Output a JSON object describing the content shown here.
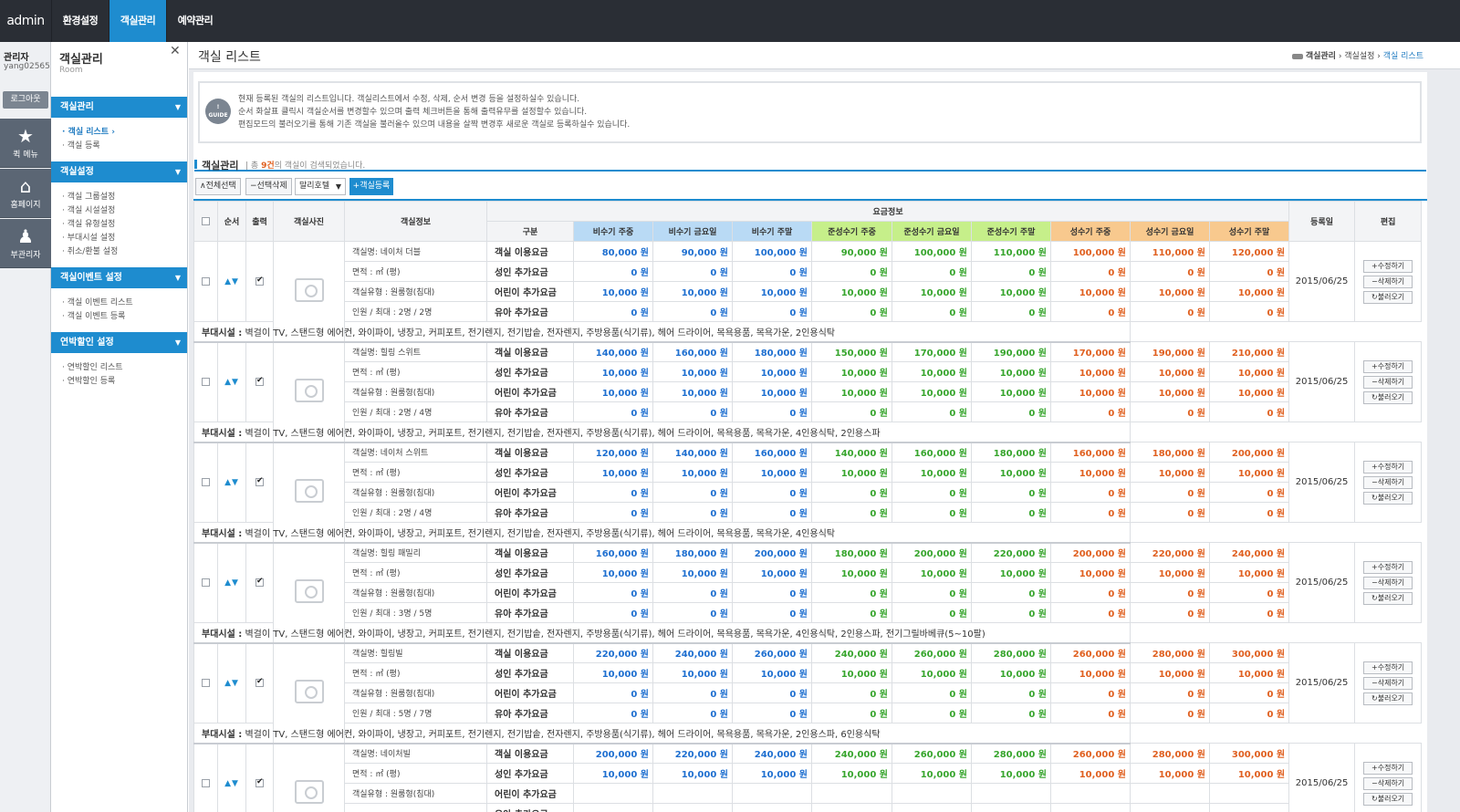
{
  "top": {
    "logo": "admin",
    "menus": [
      {
        "label": "환경설정"
      },
      {
        "label": "객실관리"
      },
      {
        "label": "예약관리"
      }
    ]
  },
  "leftstrip": {
    "admin_label": "관리자",
    "admin_id": "yang02565",
    "logout": "로그아웃",
    "quick": [
      {
        "icon": "star-icon",
        "label": "퀵 메뉴"
      },
      {
        "icon": "home-search-icon",
        "label": "홈페이지"
      },
      {
        "icon": "sub-admin-icon",
        "label": "부관리자"
      }
    ]
  },
  "sidebar": {
    "title": "객실관리",
    "subtitle": "Room",
    "groups": [
      {
        "label": "객실관리",
        "items": [
          "· 객실 리스트 ›",
          "· 객실 등록"
        ]
      },
      {
        "label": "객실설정",
        "items": [
          "· 객실 그룹설정",
          "· 객실 시설설정",
          "· 객실 유형설정",
          "· 부대시설 설정",
          "· 취소/환불 설정"
        ]
      },
      {
        "label": "객실이벤트 설정",
        "items": [
          "· 객실 이벤트 리스트",
          "· 객실 이벤트 등록"
        ]
      },
      {
        "label": "연박할인 설정",
        "items": [
          "· 연박할인 리스트",
          "· 연박할인 등록"
        ]
      }
    ]
  },
  "page": {
    "title": "객실 리스트",
    "breadcrumb": [
      "객실관리",
      "객실설정",
      "객실 리스트"
    ],
    "guide_icon": "GUIDE",
    "guide": [
      "현재 등록된 객실의 리스트입니다. 객실리스트에서 수정, 삭제, 순서 변경 등을 설정하실수 있습니다.",
      "순서 화살표 클릭시 객실순서를 변경할수 있으며 출력 체크버튼을 통해 출력유무를 설정할수 있습니다.",
      "편집모드의 불러오기를 통해 기존 객실을 불러올수 있으며 내용을 살짝 변경후 새로운 객실로 등록하실수 있습니다."
    ],
    "section_title": "객실관리",
    "section_info_pre": "총",
    "section_info_count": "9건",
    "section_info_post": "의 객실이 검색되었습니다.",
    "toolbar": {
      "select_all": "∧전체선택",
      "delete_selected": "−선택삭제",
      "select_value": "말리호텔",
      "register": "+객실등록"
    }
  },
  "table": {
    "headers": {
      "order": "순서",
      "output": "출력",
      "photo": "객실사진",
      "info": "객실정보",
      "price_group": "요금정보",
      "category": "구분",
      "regdate": "등록일",
      "edit": "편집",
      "seasons": [
        "비수기 주중",
        "비수기 금요일",
        "비수기 주말",
        "준성수기 주중",
        "준성수기 금요일",
        "준성수기 주말",
        "성수기 주중",
        "성수기 금요일",
        "성수기 주말"
      ]
    },
    "price_labels": [
      "객실 이용요금",
      "성인 추가요금",
      "어린이 추가요금",
      "유아 추가요금"
    ],
    "facility_label": "부대시설 :",
    "edit_buttons": [
      "+수정하기",
      "−삭제하기",
      "↻불러오기"
    ],
    "rows": [
      {
        "name": "객실명: 네이처 더블",
        "area": "면적 : ㎡ (평)",
        "type": "객실유형 : 원룸형(침대)",
        "people": "인원 / 최대 : 2명 / 2명",
        "date": "2015/06/25",
        "prices": [
          [
            "80,000 원",
            "90,000 원",
            "100,000 원",
            "90,000 원",
            "100,000 원",
            "110,000 원",
            "100,000 원",
            "110,000 원",
            "120,000 원"
          ],
          [
            "0 원",
            "0 원",
            "0 원",
            "0 원",
            "0 원",
            "0 원",
            "0 원",
            "0 원",
            "0 원"
          ],
          [
            "10,000 원",
            "10,000 원",
            "10,000 원",
            "10,000 원",
            "10,000 원",
            "10,000 원",
            "10,000 원",
            "10,000 원",
            "10,000 원"
          ],
          [
            "0 원",
            "0 원",
            "0 원",
            "0 원",
            "0 원",
            "0 원",
            "0 원",
            "0 원",
            "0 원"
          ]
        ],
        "facilities": "벽걸이 TV, 스탠드형 에어컨, 와이파이, 냉장고, 커피포트, 전기렌지, 전기밥솥, 전자렌지, 주방용품(식기류), 헤어 드라이어, 목욕용품, 목욕가운, 2인용식탁"
      },
      {
        "name": "객실명: 힐링 스위트",
        "area": "면적 : ㎡ (평)",
        "type": "객실유형 : 원룸형(침대)",
        "people": "인원 / 최대 : 2명 / 4명",
        "date": "2015/06/25",
        "prices": [
          [
            "140,000 원",
            "160,000 원",
            "180,000 원",
            "150,000 원",
            "170,000 원",
            "190,000 원",
            "170,000 원",
            "190,000 원",
            "210,000 원"
          ],
          [
            "10,000 원",
            "10,000 원",
            "10,000 원",
            "10,000 원",
            "10,000 원",
            "10,000 원",
            "10,000 원",
            "10,000 원",
            "10,000 원"
          ],
          [
            "10,000 원",
            "10,000 원",
            "10,000 원",
            "10,000 원",
            "10,000 원",
            "10,000 원",
            "10,000 원",
            "10,000 원",
            "10,000 원"
          ],
          [
            "0 원",
            "0 원",
            "0 원",
            "0 원",
            "0 원",
            "0 원",
            "0 원",
            "0 원",
            "0 원"
          ]
        ],
        "facilities": "벽걸이 TV, 스탠드형 에어컨, 와이파이, 냉장고, 커피포트, 전기렌지, 전기밥솥, 전자렌지, 주방용품(식기류), 헤어 드라이어, 목욕용품, 목욕가운, 4인용식탁, 2인용스파"
      },
      {
        "name": "객실명: 네이처 스위트",
        "area": "면적 : ㎡ (평)",
        "type": "객실유형 : 원룸형(침대)",
        "people": "인원 / 최대 : 2명 / 4명",
        "date": "2015/06/25",
        "prices": [
          [
            "120,000 원",
            "140,000 원",
            "160,000 원",
            "140,000 원",
            "160,000 원",
            "180,000 원",
            "160,000 원",
            "180,000 원",
            "200,000 원"
          ],
          [
            "10,000 원",
            "10,000 원",
            "10,000 원",
            "10,000 원",
            "10,000 원",
            "10,000 원",
            "10,000 원",
            "10,000 원",
            "10,000 원"
          ],
          [
            "0 원",
            "0 원",
            "0 원",
            "0 원",
            "0 원",
            "0 원",
            "0 원",
            "0 원",
            "0 원"
          ],
          [
            "0 원",
            "0 원",
            "0 원",
            "0 원",
            "0 원",
            "0 원",
            "0 원",
            "0 원",
            "0 원"
          ]
        ],
        "facilities": "벽걸이 TV, 스탠드형 에어컨, 와이파이, 냉장고, 커피포트, 전기렌지, 전기밥솥, 전자렌지, 주방용품(식기류), 헤어 드라이어, 목욕용품, 목욕가운, 4인용식탁"
      },
      {
        "name": "객실명: 힐링 패밀리",
        "area": "면적 : ㎡ (평)",
        "type": "객실유형 : 원룸형(침대)",
        "people": "인원 / 최대 : 3명 / 5명",
        "date": "2015/06/25",
        "prices": [
          [
            "160,000 원",
            "180,000 원",
            "200,000 원",
            "180,000 원",
            "200,000 원",
            "220,000 원",
            "200,000 원",
            "220,000 원",
            "240,000 원"
          ],
          [
            "10,000 원",
            "10,000 원",
            "10,000 원",
            "10,000 원",
            "10,000 원",
            "10,000 원",
            "10,000 원",
            "10,000 원",
            "10,000 원"
          ],
          [
            "0 원",
            "0 원",
            "0 원",
            "0 원",
            "0 원",
            "0 원",
            "0 원",
            "0 원",
            "0 원"
          ],
          [
            "0 원",
            "0 원",
            "0 원",
            "0 원",
            "0 원",
            "0 원",
            "0 원",
            "0 원",
            "0 원"
          ]
        ],
        "facilities": "벽걸이 TV, 스탠드형 에어컨, 와이파이, 냉장고, 커피포트, 전기렌지, 전기밥솥, 전자렌지, 주방용품(식기류), 헤어 드라이어, 목욕용품, 목욕가운, 4인용식탁, 2인용스파, 전기그릴바베큐(5~10팔)"
      },
      {
        "name": "객실명: 힐링빌",
        "area": "면적 : ㎡ (평)",
        "type": "객실유형 : 원룸형(침대)",
        "people": "인원 / 최대 : 5명 / 7명",
        "date": "2015/06/25",
        "prices": [
          [
            "220,000 원",
            "240,000 원",
            "260,000 원",
            "240,000 원",
            "260,000 원",
            "280,000 원",
            "260,000 원",
            "280,000 원",
            "300,000 원"
          ],
          [
            "10,000 원",
            "10,000 원",
            "10,000 원",
            "10,000 원",
            "10,000 원",
            "10,000 원",
            "10,000 원",
            "10,000 원",
            "10,000 원"
          ],
          [
            "0 원",
            "0 원",
            "0 원",
            "0 원",
            "0 원",
            "0 원",
            "0 원",
            "0 원",
            "0 원"
          ],
          [
            "0 원",
            "0 원",
            "0 원",
            "0 원",
            "0 원",
            "0 원",
            "0 원",
            "0 원",
            "0 원"
          ]
        ],
        "facilities": "벽걸이 TV, 스탠드형 에어컨, 와이파이, 냉장고, 커피포트, 전기렌지, 전기밥솥, 전자렌지, 주방용품(식기류), 헤어 드라이어, 목욕용품, 목욕가운, 2인용스파, 6인용식탁"
      },
      {
        "name": "객실명: 네이처빌",
        "area": "면적 : ㎡ (평)",
        "type": "객실유형 : 원룸형(침대)",
        "people": "",
        "date": "2015/06/25",
        "prices": [
          [
            "200,000 원",
            "220,000 원",
            "240,000 원",
            "240,000 원",
            "260,000 원",
            "280,000 원",
            "260,000 원",
            "280,000 원",
            "300,000 원"
          ],
          [
            "10,000 원",
            "10,000 원",
            "10,000 원",
            "10,000 원",
            "10,000 원",
            "10,000 원",
            "10,000 원",
            "10,000 원",
            "10,000 원"
          ],
          [
            "",
            "",
            "",
            "",
            "",
            "",
            "",
            "",
            ""
          ],
          [
            "",
            "",
            "",
            "",
            "",
            "",
            "",
            "",
            ""
          ]
        ],
        "facilities": ""
      }
    ]
  }
}
